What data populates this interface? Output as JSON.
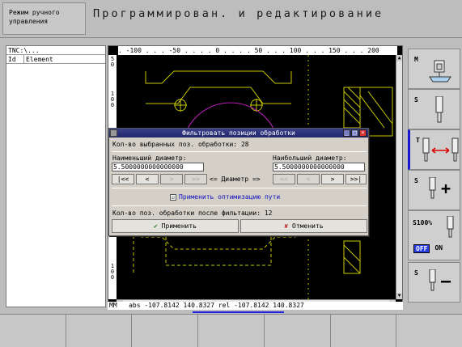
{
  "header": {
    "mode": "Режим ручного\nуправления",
    "title": "Программирован. и редактирование"
  },
  "tree": {
    "path": "TNC:\\...",
    "col_id": "Id",
    "col_element": "Element"
  },
  "graphics": {
    "ruler_top": ". -100 . . . -50 . . . . 0 . . . . 50 . . . 100 . . . 150 . . . 200",
    "ruler_left_top": "50",
    "ruler_left_mid": "100",
    "ruler_left_bottom": "100",
    "status": "MM   abs -107.8142 140.8327 rel -107.8142 140.8327"
  },
  "dialog": {
    "title": "Фильтровать позиции обработки",
    "selected_label": "Кол-во выбранных поз. обработки: 28",
    "min_label": "Наименьший диаметр:",
    "max_label": "Наибольший диаметр:",
    "min_value": "5.5000000000000000",
    "max_value": "5.5000000000000000",
    "nav_left": [
      "|<<",
      "<",
      ">",
      ">>"
    ],
    "diameter_label": "<= Диаметр =>",
    "nav_right": [
      "<<",
      "<",
      ">",
      ">>|"
    ],
    "check_mark": "☑",
    "optimize_label": "Применить оптимизацию пути",
    "after_filter_label": "Кол-во поз. обработки после фильтации: 12",
    "apply_label": "Применить",
    "cancel_label": "Отменить"
  },
  "right_panel": {
    "m_label": "M",
    "s_label": "S",
    "t_label": "T",
    "s2_label": "S",
    "s100_label": "S100%",
    "off_label": "OFF",
    "on_label": "ON",
    "s3_label": "S",
    "plus": "+",
    "minus": "—"
  },
  "colors": {
    "drawing": "#c8c800",
    "arc": "#c020c0",
    "dialog_title": "#2a2e78",
    "accent": "#1717d0"
  }
}
